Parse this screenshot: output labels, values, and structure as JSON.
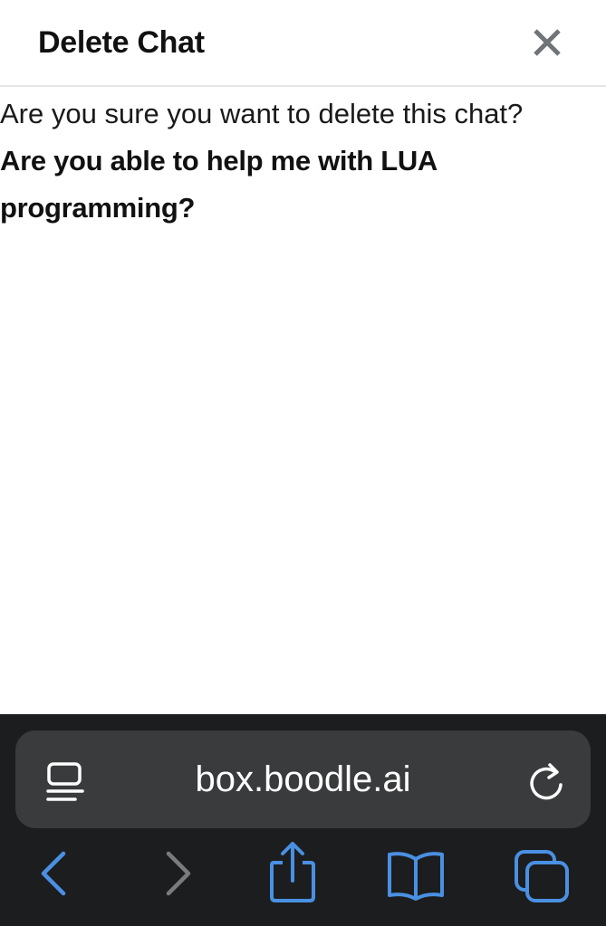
{
  "modal": {
    "title": "Delete Chat",
    "close_icon": "close-icon",
    "confirm_text": "Are you sure you want to delete this chat?",
    "chat_title": "Are you able to help me with LUA programming?"
  },
  "browser": {
    "url": "box.boodle.ai",
    "reader_icon": "reader-view-icon",
    "reload_icon": "reload-icon",
    "toolbar": [
      {
        "name": "back",
        "icon": "chevron-left-icon"
      },
      {
        "name": "forward",
        "icon": "chevron-right-icon"
      },
      {
        "name": "share",
        "icon": "share-icon"
      },
      {
        "name": "bookmarks",
        "icon": "book-icon"
      },
      {
        "name": "tabs",
        "icon": "tabs-icon"
      }
    ],
    "accent_color": "#4a90e2",
    "disabled_color": "#7a7b7d"
  }
}
